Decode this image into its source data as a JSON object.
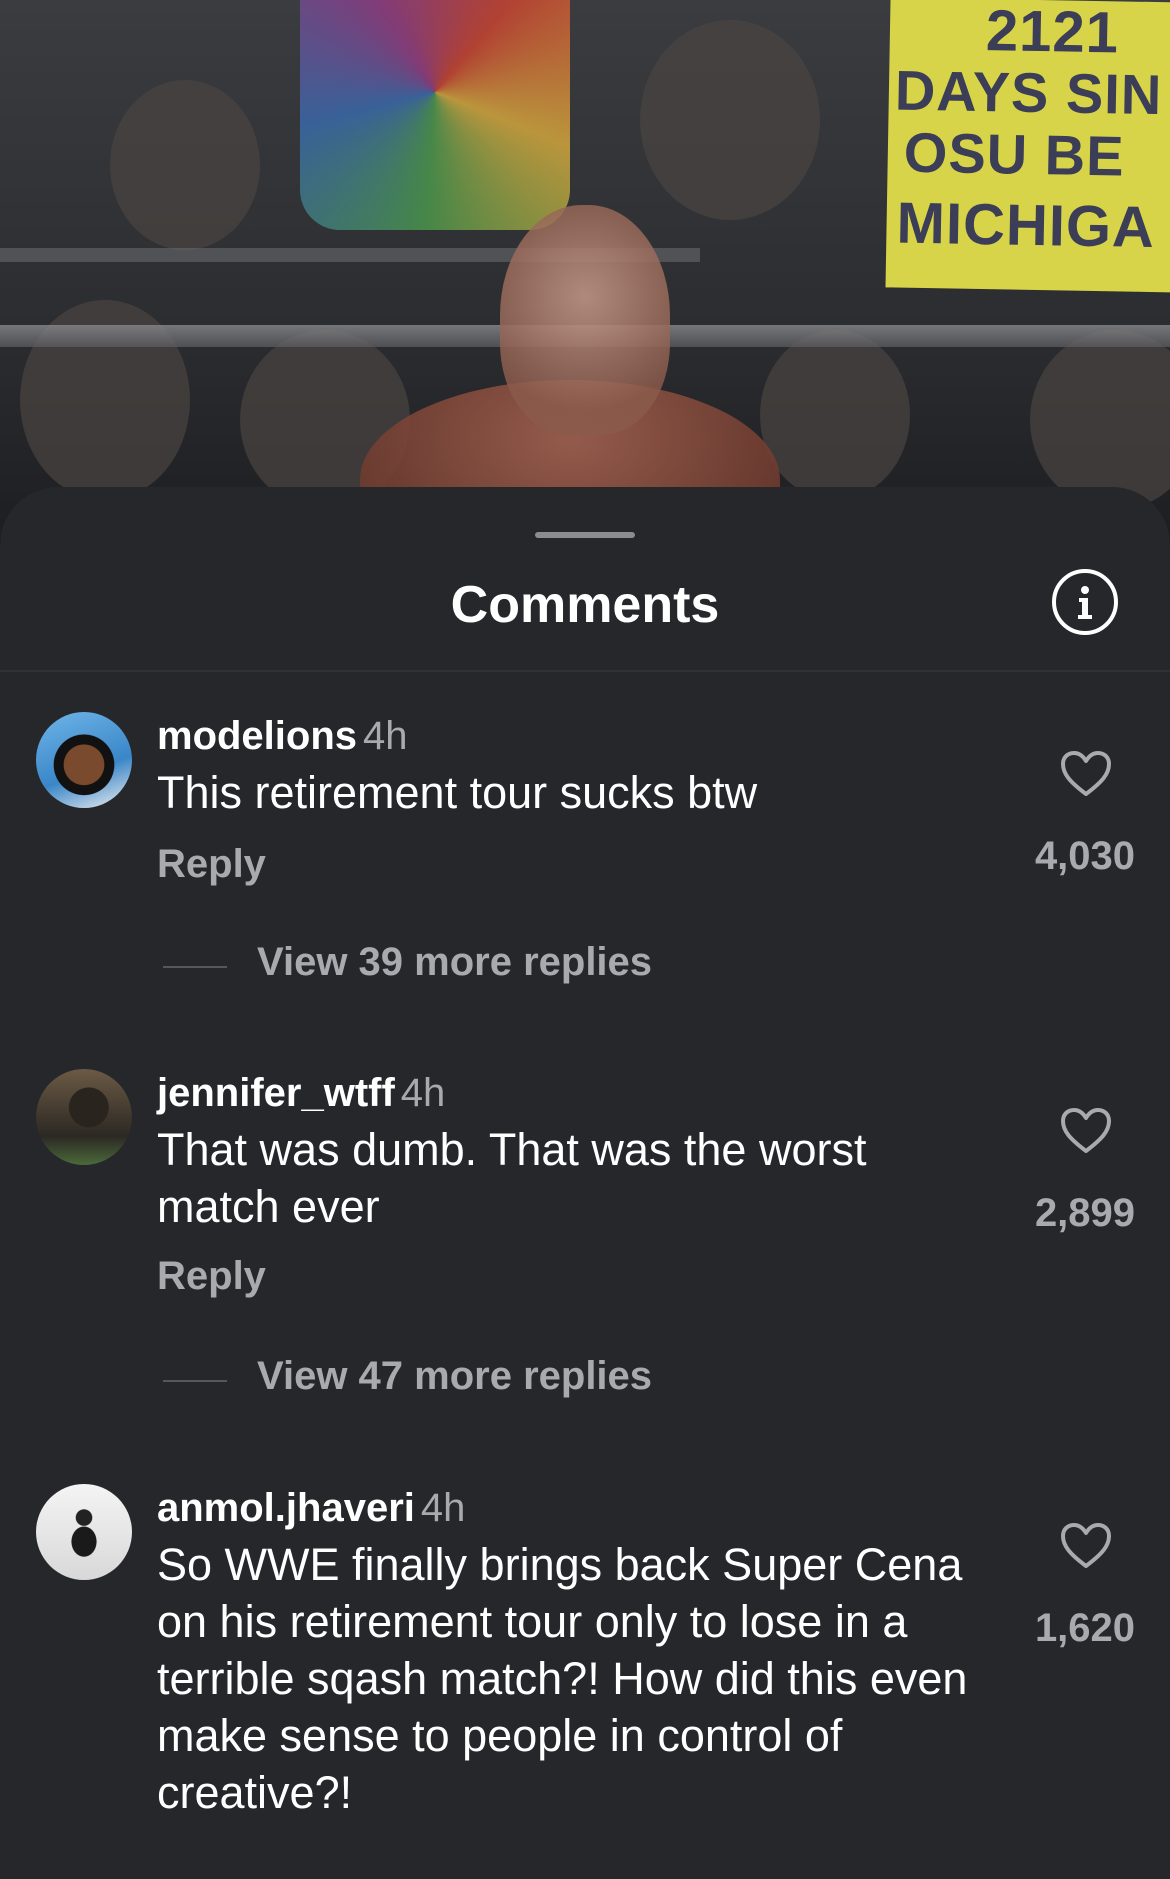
{
  "video": {
    "sign_lines": [
      "2121",
      "DAYS SIN",
      "OSU  BE",
      "MICHIGA"
    ]
  },
  "sheet": {
    "title": "Comments"
  },
  "comments": [
    {
      "username": "modelions",
      "time": "4h",
      "text": "This retirement tour sucks btw",
      "reply_label": "Reply",
      "likes": "4,030",
      "view_replies": "View 39 more replies"
    },
    {
      "username": "jennifer_wtff",
      "time": "4h",
      "text": "That was dumb. That was the worst match ever",
      "reply_label": "Reply",
      "likes": "2,899",
      "view_replies": "View 47 more replies"
    },
    {
      "username": "anmol.jhaveri",
      "time": "4h",
      "text": "So WWE finally brings back Super Cena on his retirement tour only to lose in a terrible sqash match?! How did this even make sense to people in control of creative?!",
      "likes": "1,620"
    }
  ],
  "icons": {
    "info": "info-icon",
    "like": "heart-icon"
  },
  "colors": {
    "sheet_bg": "#25272b",
    "primary_text": "#ffffff",
    "secondary_text": "#a8aab0"
  }
}
